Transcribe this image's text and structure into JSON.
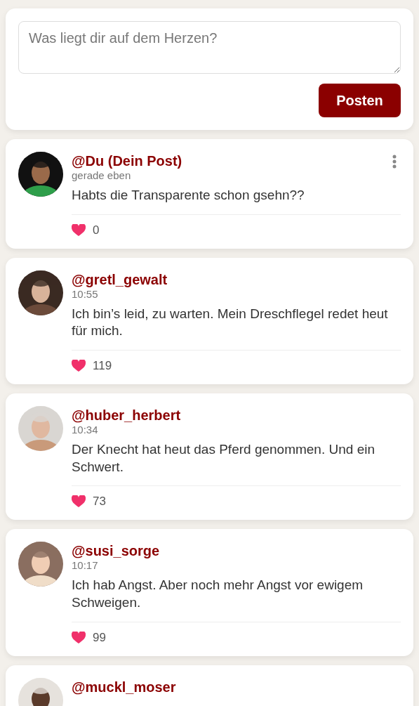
{
  "composer": {
    "placeholder": "Was liegt dir auf dem Herzen?",
    "button": "Posten"
  },
  "posts": [
    {
      "author": "@Du (Dein Post)",
      "time": "gerade eben",
      "text": "Habts die Transparente schon gsehn??",
      "likes": "0",
      "menu": true
    },
    {
      "author": "@gretl_gewalt",
      "time": "10:55",
      "text": "Ich bin’s leid, zu warten. Mein Dreschflegel redet heut für mich.",
      "likes": "119",
      "menu": false
    },
    {
      "author": "@huber_herbert",
      "time": "10:34",
      "text": "Der Knecht hat heut das Pferd genommen. Und ein Schwert.",
      "likes": "73",
      "menu": false
    },
    {
      "author": "@susi_sorge",
      "time": "10:17",
      "text": "Ich hab Angst. Aber noch mehr Angst vor ewigem Schweigen.",
      "likes": "99",
      "menu": false
    },
    {
      "author": "@muckl_moser",
      "menu": false
    }
  ]
}
